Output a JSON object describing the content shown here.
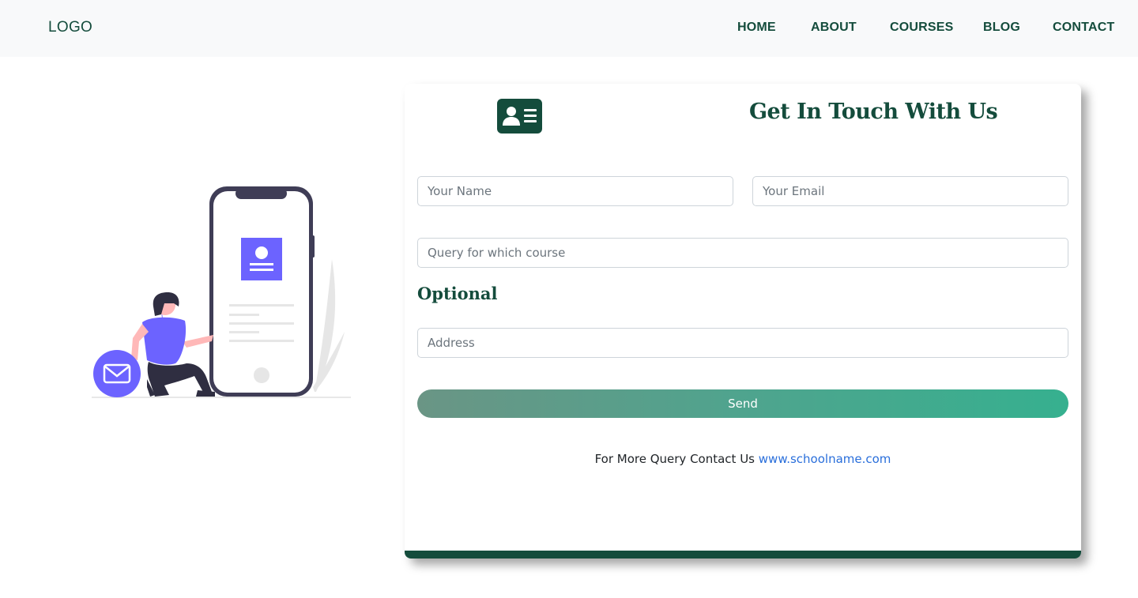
{
  "navbar": {
    "logo": "LOGO",
    "links": [
      "HOME",
      "ABOUT",
      "COURSES",
      "BLOG",
      "CONTACT"
    ]
  },
  "card": {
    "icon": "contact-card-icon",
    "title": "Get In Touch With Us",
    "fields": {
      "name_placeholder": "Your Name",
      "email_placeholder": "Your Email",
      "query_placeholder": "Query for which course",
      "address_placeholder": "Address"
    },
    "optional_label": "Optional",
    "send_label": "Send",
    "footer_text": "For More Query Contact Us",
    "footer_link": "www.schoolname.com"
  },
  "illustration": {
    "icon": "person-phone-mail-illustration"
  },
  "colors": {
    "brand_green": "#144c3c",
    "navbar_bg": "#f8f9fa",
    "accent_purple": "#6c63ff",
    "link_blue": "#2a6fdb"
  }
}
